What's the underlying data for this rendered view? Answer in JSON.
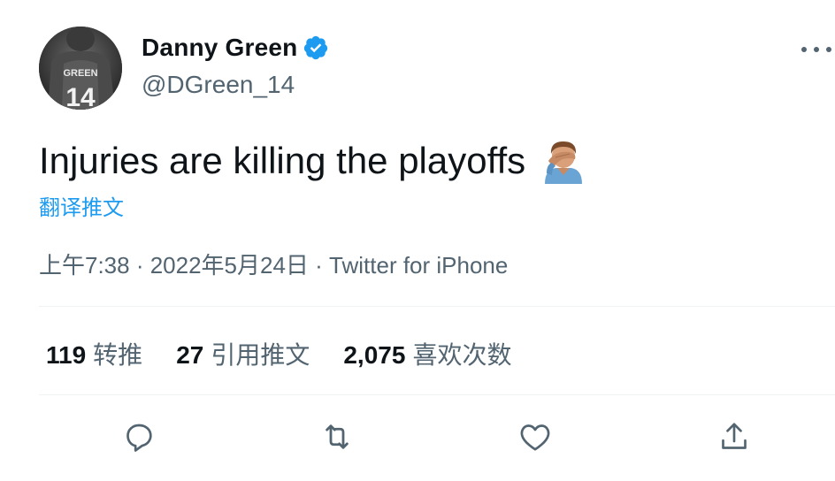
{
  "author": {
    "display_name": "Danny Green",
    "handle": "@DGreen_14",
    "verified": true,
    "avatar_jersey_name": "GREEN",
    "avatar_jersey_number": "14"
  },
  "tweet": {
    "text": "Injuries are killing the playoffs",
    "emoji": "facepalm-emoji",
    "translate_label": "翻译推文"
  },
  "meta": {
    "line": "上午7:38 · 2022年5月24日 · Twitter for iPhone"
  },
  "stats": [
    {
      "value": "119",
      "label": "转推"
    },
    {
      "value": "27",
      "label": "引用推文"
    },
    {
      "value": "2,075",
      "label": "喜欢次数"
    }
  ],
  "colors": {
    "accent": "#1d9bf0",
    "text": "#0f1419",
    "secondary": "#536471",
    "divider": "#eff3f4"
  },
  "icons": {
    "more": "more-horizontal-icon",
    "reply": "reply-icon",
    "retweet": "retweet-icon",
    "like": "heart-icon",
    "share": "share-icon",
    "verified": "verified-badge-icon"
  }
}
